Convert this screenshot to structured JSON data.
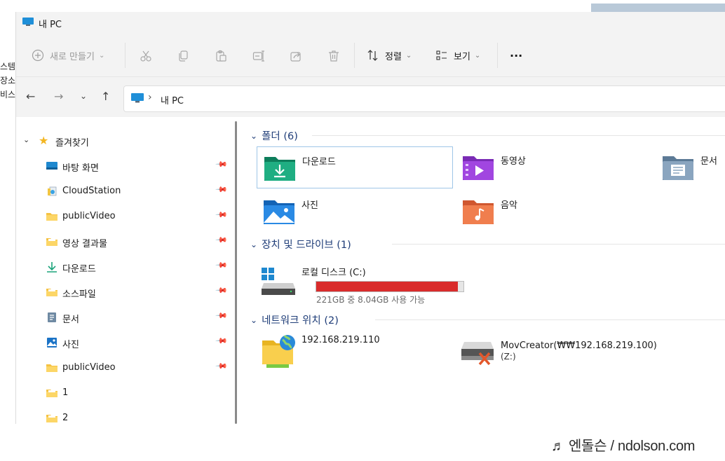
{
  "background": {
    "left_text": [
      "스템",
      "장소",
      "비스"
    ]
  },
  "window": {
    "title": "내 PC"
  },
  "toolbar": {
    "new_label": "새로 만들기",
    "sort_label": "정렬",
    "view_label": "보기",
    "more_label": "···"
  },
  "address": {
    "path": "내 PC"
  },
  "sidebar": {
    "favorites_label": "즐겨찾기",
    "items": [
      {
        "label": "바탕 화면",
        "icon": "desktop-icon",
        "pinned": true
      },
      {
        "label": "CloudStation",
        "icon": "cloud-folder-icon",
        "pinned": true
      },
      {
        "label": "publicVideo",
        "icon": "folder-icon",
        "pinned": true
      },
      {
        "label": "영상 결과물",
        "icon": "folder-icon",
        "pinned": true
      },
      {
        "label": "다운로드",
        "icon": "download-icon",
        "pinned": true
      },
      {
        "label": "소스파일",
        "icon": "folder-icon",
        "pinned": true
      },
      {
        "label": "문서",
        "icon": "document-icon",
        "pinned": true
      },
      {
        "label": "사진",
        "icon": "pictures-icon",
        "pinned": true
      },
      {
        "label": "publicVideo",
        "icon": "folder-icon",
        "pinned": true
      },
      {
        "label": "1",
        "icon": "folder-icon",
        "pinned": false
      },
      {
        "label": "2",
        "icon": "folder-icon",
        "pinned": false
      }
    ]
  },
  "content": {
    "folders_header": "폴더 (6)",
    "folders": [
      {
        "label": "다운로드",
        "icon": "downloads-folder-icon"
      },
      {
        "label": "동영상",
        "icon": "videos-folder-icon"
      },
      {
        "label": "문서",
        "icon": "documents-folder-icon"
      },
      {
        "label": "사진",
        "icon": "pictures-folder-icon"
      },
      {
        "label": "음악",
        "icon": "music-folder-icon"
      }
    ],
    "drives_header": "장치 및 드라이브 (1)",
    "drive": {
      "label": "로컬 디스크 (C:)",
      "usage_text": "221GB 중 8.04GB 사용 가능",
      "used_fraction": 0.964,
      "bar_color": "#d92b2b"
    },
    "network_header": "네트워크 위치 (2)",
    "network": [
      {
        "label": "192.168.219.110",
        "icon": "network-folder-icon"
      },
      {
        "label_line1": "MovCreator(₩₩192.168.219.100)",
        "label_line2": "(Z:)",
        "icon": "disconnected-drive-icon"
      }
    ]
  },
  "watermark": {
    "text": "♬ 엔돌슨 / ndolson.com"
  }
}
